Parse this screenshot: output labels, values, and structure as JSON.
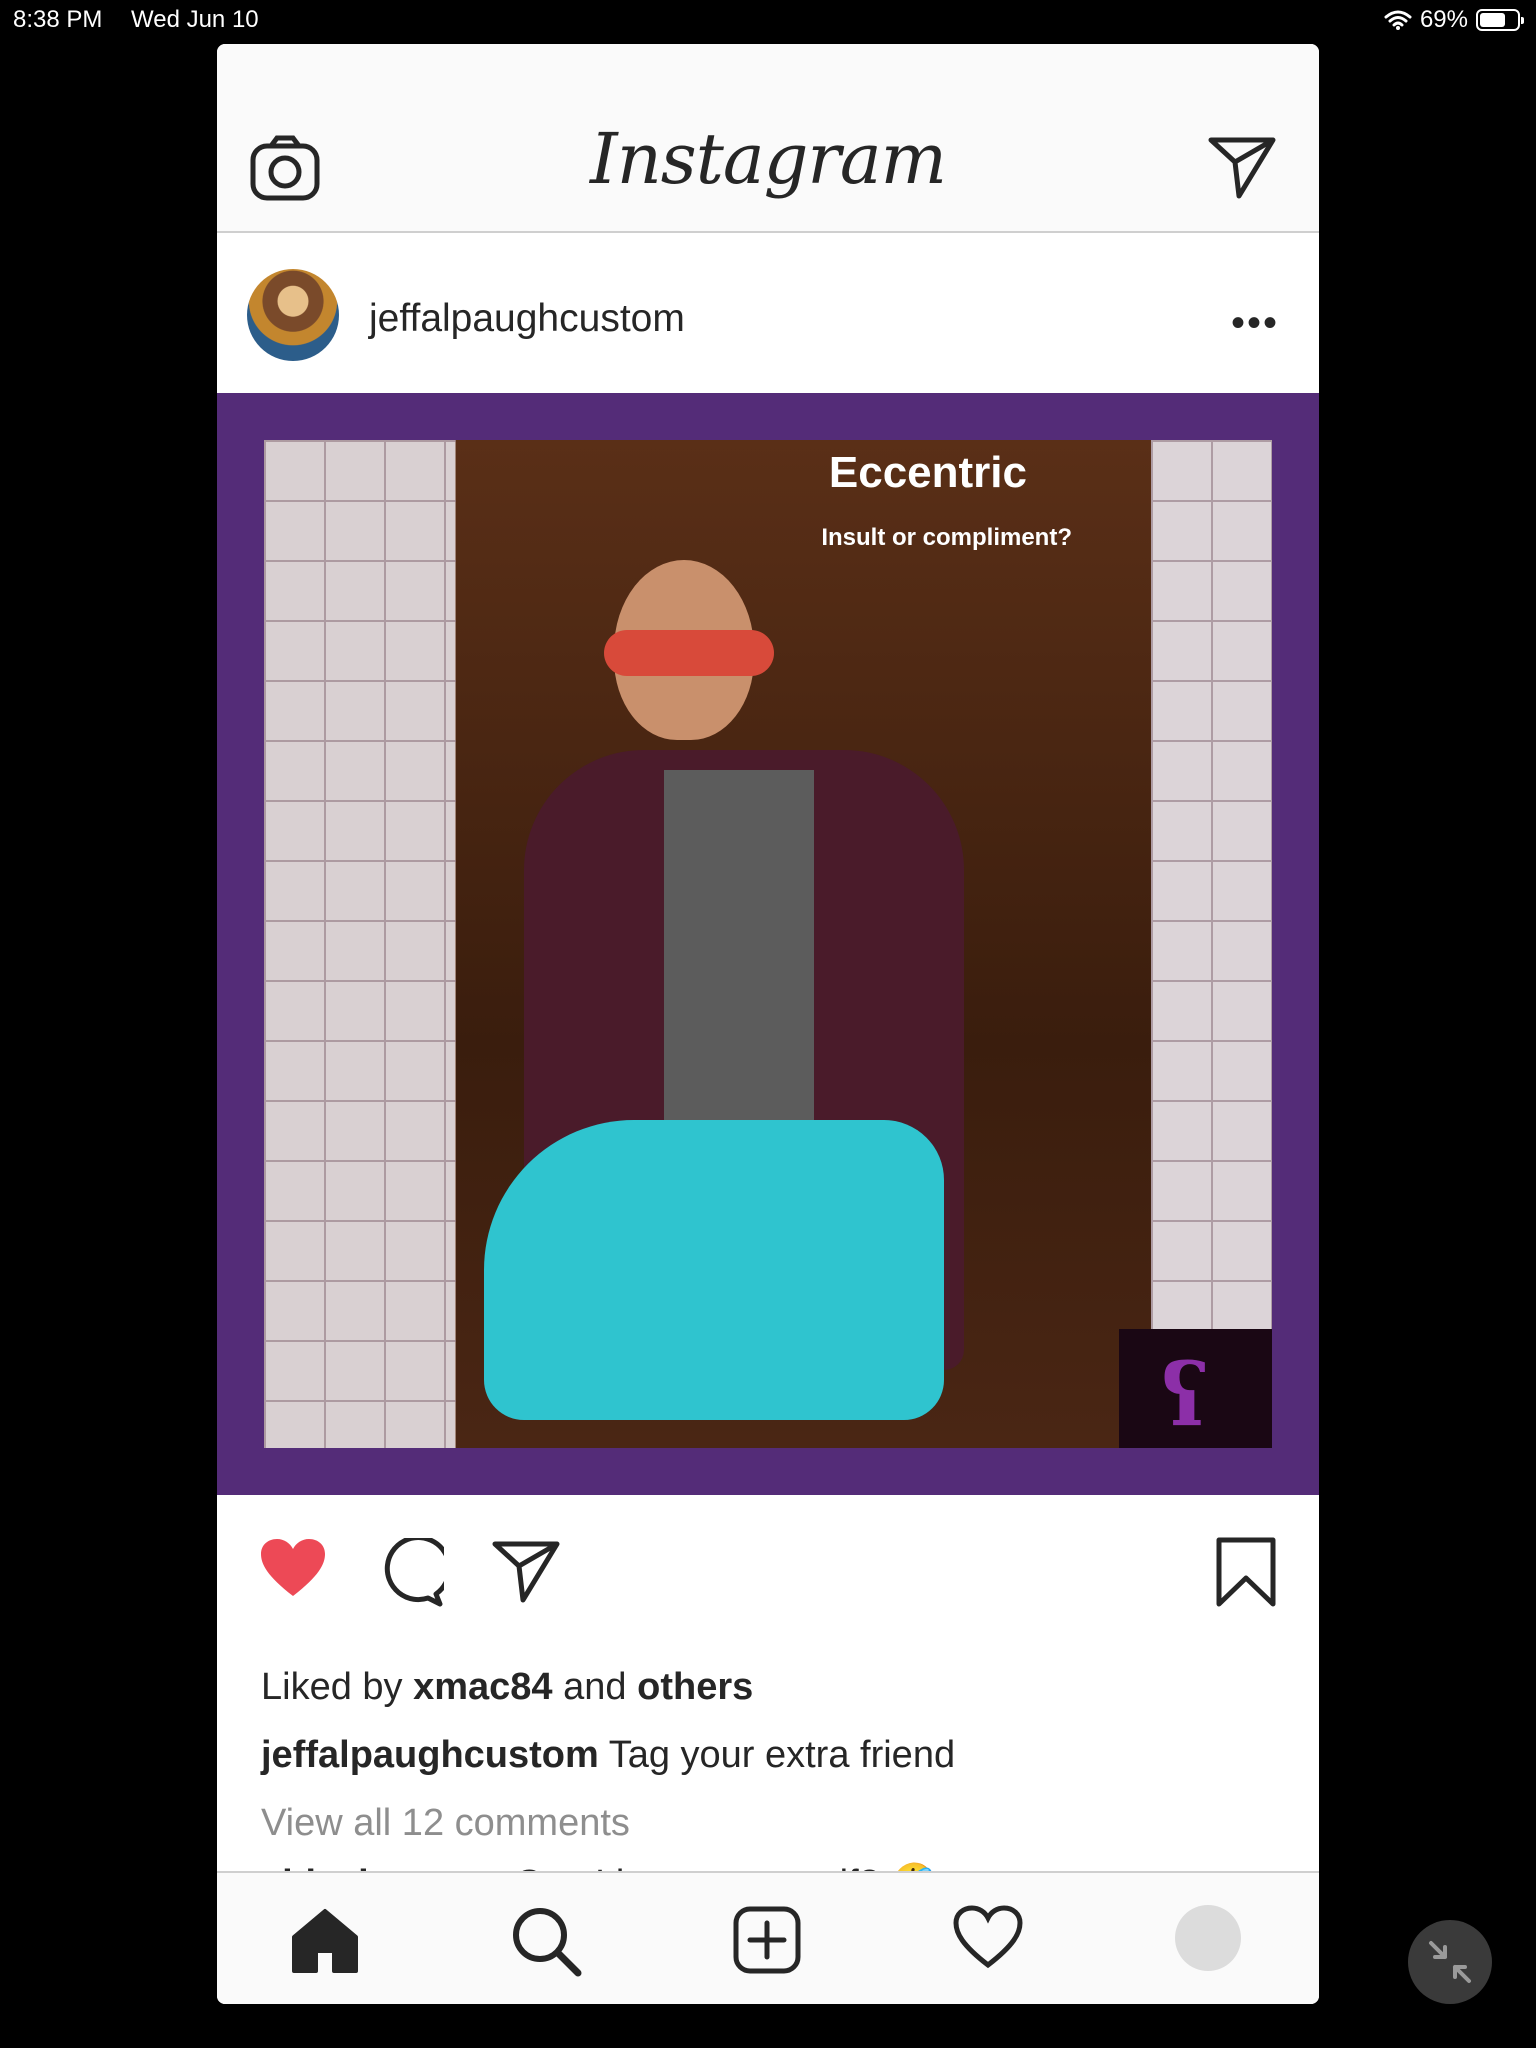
{
  "status_bar": {
    "time": "8:38 PM",
    "date": "Wed Jun 10",
    "battery": "69%",
    "battery_level": 0.69
  },
  "app": {
    "title": "Instagram",
    "post": {
      "username": "jeffalpaugh​custom",
      "image_title": "Eccentric",
      "image_subtitle": "Insult or compliment?",
      "badge_mark": "ʕ",
      "liked_by_prefix": "Liked by",
      "liked_by_user": "xmac84",
      "liked_by_and": "and",
      "liked_by_others": "others",
      "caption_user": "jeffalpaughcustom",
      "caption_text": "Tag your extra friend",
      "view_comments": "View all 12 comments",
      "comment_user": "cldesignteam",
      "comment_text": "Can I just tag myself? 🤣",
      "liked": true
    },
    "icons": {
      "camera": "camera-icon",
      "direct": "paper-plane-icon",
      "more": "more-dots-icon",
      "like": "heart-icon",
      "comment": "comment-icon",
      "share": "paper-plane-icon",
      "save": "bookmark-icon",
      "home": "home-icon",
      "search": "search-icon",
      "add": "add-post-icon",
      "activity": "heart-outline-icon",
      "profile": "profile-avatar-icon"
    },
    "colors": {
      "like_red": "#ed4956",
      "post_frame": "#542c78",
      "accent_text": "#262626",
      "muted_text": "#8e8e8e"
    }
  }
}
